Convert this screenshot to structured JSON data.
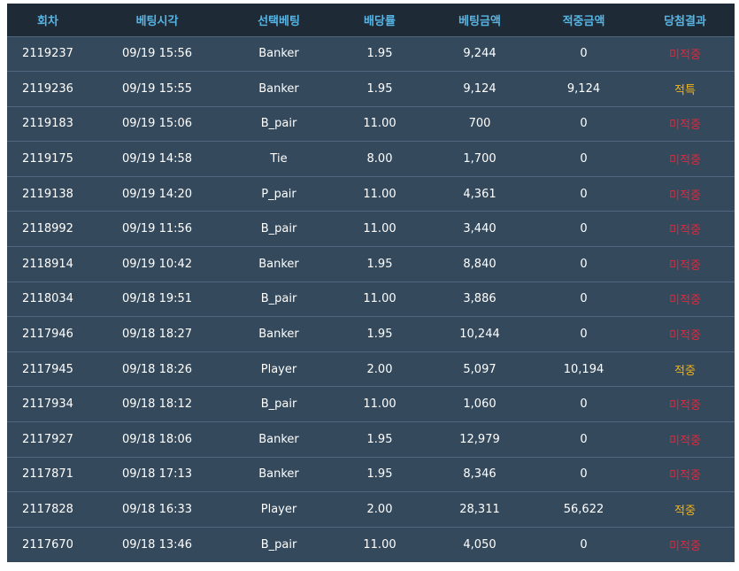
{
  "colors": {
    "header_bg": "#1e2b36",
    "header_text": "#58b4e4",
    "row_bg": "#34495c",
    "row_border": "#4f6880",
    "text": "#ffffff",
    "lose": "#e0283c",
    "win": "#f2b417"
  },
  "table": {
    "columns": [
      "회차",
      "베팅시각",
      "선택베팅",
      "배당률",
      "베팅금액",
      "적중금액",
      "당첨결과"
    ],
    "rows": [
      {
        "round": "2119237",
        "time": "09/19 15:56",
        "pick": "Banker",
        "odds": "1.95",
        "bet": "9,244",
        "payout": "0",
        "result": "미적중",
        "status": "lose"
      },
      {
        "round": "2119236",
        "time": "09/19 15:55",
        "pick": "Banker",
        "odds": "1.95",
        "bet": "9,124",
        "payout": "9,124",
        "result": "적특",
        "status": "win"
      },
      {
        "round": "2119183",
        "time": "09/19 15:06",
        "pick": "B_pair",
        "odds": "11.00",
        "bet": "700",
        "payout": "0",
        "result": "미적중",
        "status": "lose"
      },
      {
        "round": "2119175",
        "time": "09/19 14:58",
        "pick": "Tie",
        "odds": "8.00",
        "bet": "1,700",
        "payout": "0",
        "result": "미적중",
        "status": "lose"
      },
      {
        "round": "2119138",
        "time": "09/19 14:20",
        "pick": "P_pair",
        "odds": "11.00",
        "bet": "4,361",
        "payout": "0",
        "result": "미적중",
        "status": "lose"
      },
      {
        "round": "2118992",
        "time": "09/19 11:56",
        "pick": "B_pair",
        "odds": "11.00",
        "bet": "3,440",
        "payout": "0",
        "result": "미적중",
        "status": "lose"
      },
      {
        "round": "2118914",
        "time": "09/19 10:42",
        "pick": "Banker",
        "odds": "1.95",
        "bet": "8,840",
        "payout": "0",
        "result": "미적중",
        "status": "lose"
      },
      {
        "round": "2118034",
        "time": "09/18 19:51",
        "pick": "B_pair",
        "odds": "11.00",
        "bet": "3,886",
        "payout": "0",
        "result": "미적중",
        "status": "lose"
      },
      {
        "round": "2117946",
        "time": "09/18 18:27",
        "pick": "Banker",
        "odds": "1.95",
        "bet": "10,244",
        "payout": "0",
        "result": "미적중",
        "status": "lose"
      },
      {
        "round": "2117945",
        "time": "09/18 18:26",
        "pick": "Player",
        "odds": "2.00",
        "bet": "5,097",
        "payout": "10,194",
        "result": "적중",
        "status": "win"
      },
      {
        "round": "2117934",
        "time": "09/18 18:12",
        "pick": "B_pair",
        "odds": "11.00",
        "bet": "1,060",
        "payout": "0",
        "result": "미적중",
        "status": "lose"
      },
      {
        "round": "2117927",
        "time": "09/18 18:06",
        "pick": "Banker",
        "odds": "1.95",
        "bet": "12,979",
        "payout": "0",
        "result": "미적중",
        "status": "lose"
      },
      {
        "round": "2117871",
        "time": "09/18 17:13",
        "pick": "Banker",
        "odds": "1.95",
        "bet": "8,346",
        "payout": "0",
        "result": "미적중",
        "status": "lose"
      },
      {
        "round": "2117828",
        "time": "09/18 16:33",
        "pick": "Player",
        "odds": "2.00",
        "bet": "28,311",
        "payout": "56,622",
        "result": "적중",
        "status": "win"
      },
      {
        "round": "2117670",
        "time": "09/18 13:46",
        "pick": "B_pair",
        "odds": "11.00",
        "bet": "4,050",
        "payout": "0",
        "result": "미적중",
        "status": "lose"
      }
    ]
  }
}
